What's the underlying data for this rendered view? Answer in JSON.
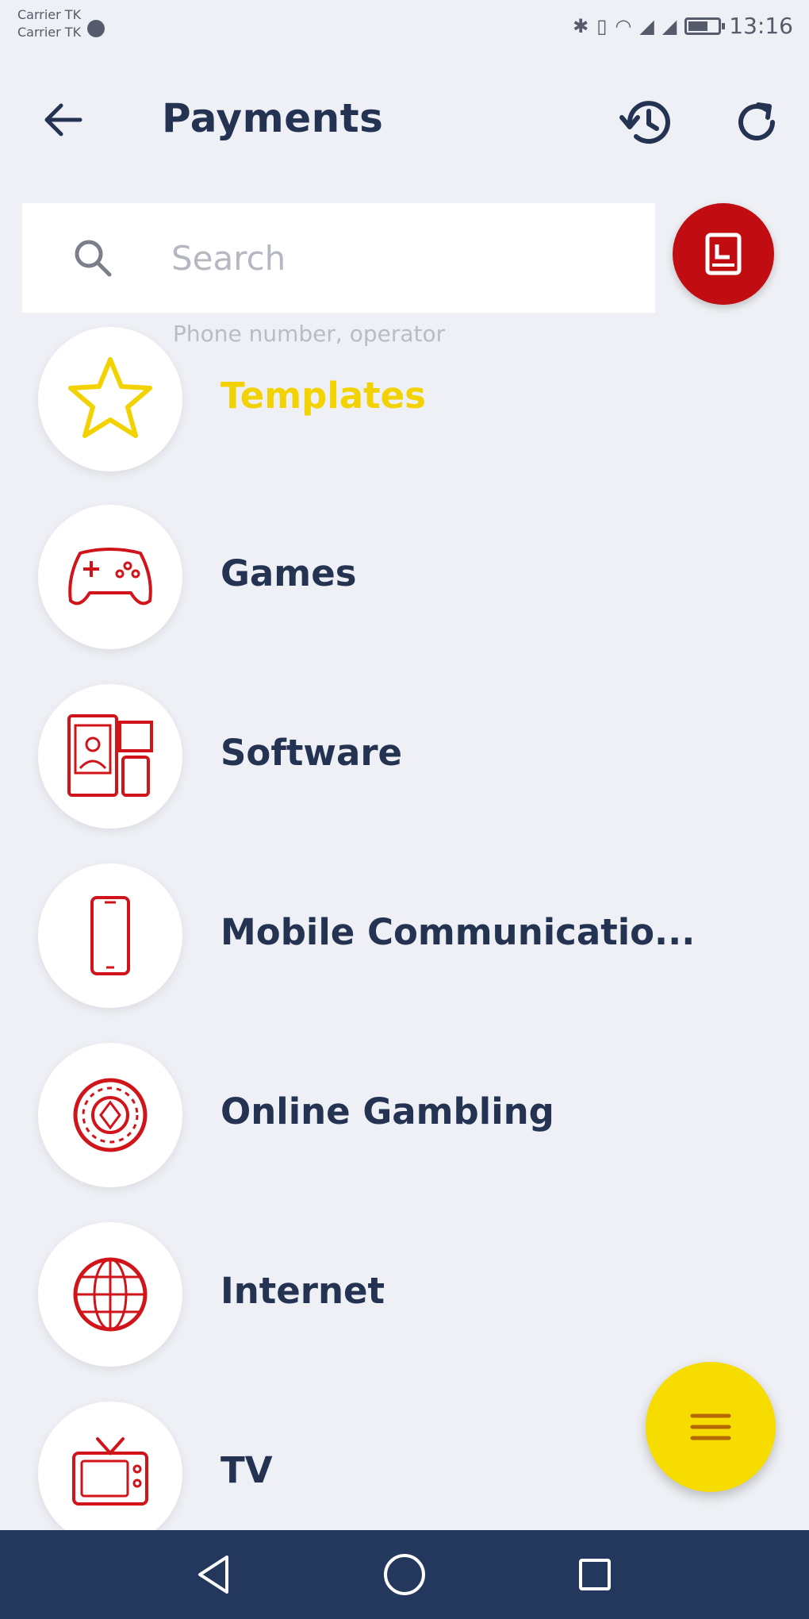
{
  "status_bar": {
    "carrier_1": "Carrier TK",
    "carrier_2": "Carrier TK",
    "time": "13:16"
  },
  "header": {
    "title": "Payments",
    "back_icon": "arrow-left-icon",
    "history_icon": "history-icon",
    "refresh_icon": "refresh-icon"
  },
  "search": {
    "placeholder": "Search",
    "hint": "Phone number, operator",
    "card_button_icon": "card-icon"
  },
  "categories": [
    {
      "label": "Templates",
      "icon": "star-icon"
    },
    {
      "label": "Games",
      "icon": "gamepad-icon"
    },
    {
      "label": "Software",
      "icon": "devices-icon"
    },
    {
      "label": "Mobile Communicatio...",
      "icon": "phone-icon"
    },
    {
      "label": "Online Gambling",
      "icon": "casino-chip-icon"
    },
    {
      "label": "Internet",
      "icon": "globe-icon"
    },
    {
      "label": "TV",
      "icon": "tv-icon"
    }
  ],
  "fab": {
    "icon": "menu-icon"
  },
  "colors": {
    "accent_red": "#c10d12",
    "accent_yellow": "#f7dc00",
    "template_yellow": "#f2d200",
    "nav_bar": "#24375c",
    "background": "#eef0f5"
  }
}
